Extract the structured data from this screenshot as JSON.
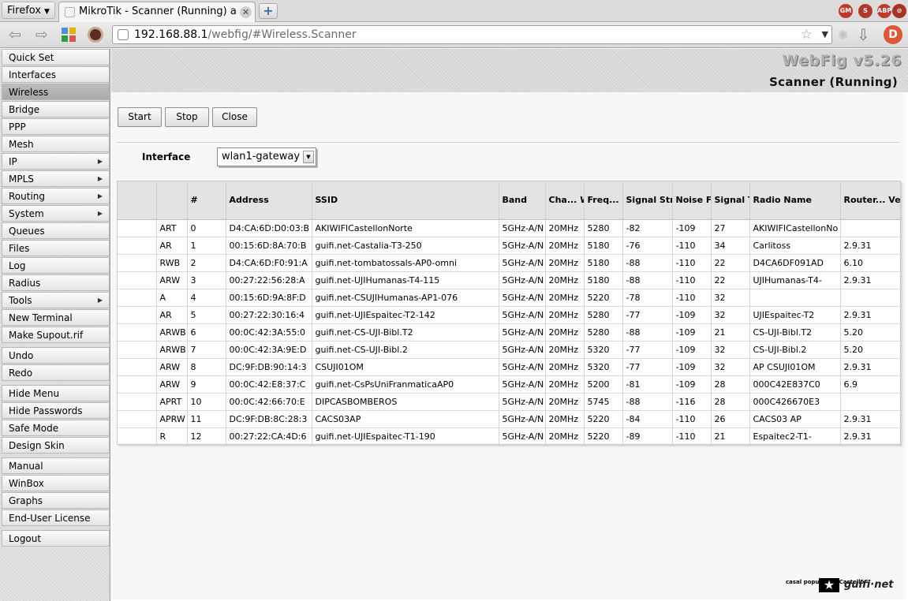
{
  "browser": {
    "menu_label": "Firefox",
    "tab_title": "MikroTik - Scanner (Running) at...",
    "url_host": "192.168.88.1",
    "url_path": "/webfig/#Wireless.Scanner",
    "addons": [
      {
        "name": "gm-icon",
        "label": "GM",
        "color": "#c0392b"
      },
      {
        "name": "noscript-icon",
        "label": "S",
        "color": "#b03a2e"
      },
      {
        "name": "abp-icon",
        "label": "ABP",
        "color": "#c0392b"
      },
      {
        "name": "blocker-icon",
        "label": "⊘",
        "color": "#a93226"
      }
    ]
  },
  "sidebar": {
    "items": [
      {
        "label": "Quick Set",
        "arrow": false,
        "active": false
      },
      {
        "label": "Interfaces",
        "arrow": false,
        "active": false
      },
      {
        "label": "Wireless",
        "arrow": false,
        "active": true
      },
      {
        "label": "Bridge",
        "arrow": false,
        "active": false
      },
      {
        "label": "PPP",
        "arrow": false,
        "active": false
      },
      {
        "label": "Mesh",
        "arrow": false,
        "active": false
      },
      {
        "label": "IP",
        "arrow": true,
        "active": false
      },
      {
        "label": "MPLS",
        "arrow": true,
        "active": false
      },
      {
        "label": "Routing",
        "arrow": true,
        "active": false
      },
      {
        "label": "System",
        "arrow": true,
        "active": false
      },
      {
        "label": "Queues",
        "arrow": false,
        "active": false
      },
      {
        "label": "Files",
        "arrow": false,
        "active": false
      },
      {
        "label": "Log",
        "arrow": false,
        "active": false
      },
      {
        "label": "Radius",
        "arrow": false,
        "active": false
      },
      {
        "label": "Tools",
        "arrow": true,
        "active": false
      },
      {
        "label": "New Terminal",
        "arrow": false,
        "active": false
      },
      {
        "label": "Make Supout.rif",
        "arrow": false,
        "active": false
      },
      {
        "label": "Undo",
        "arrow": false,
        "active": false
      },
      {
        "label": "Redo",
        "arrow": false,
        "active": false
      },
      {
        "label": "Hide Menu",
        "arrow": false,
        "active": false
      },
      {
        "label": "Hide Passwords",
        "arrow": false,
        "active": false
      },
      {
        "label": "Safe Mode",
        "arrow": false,
        "active": false
      },
      {
        "label": "Design Skin",
        "arrow": false,
        "active": false
      },
      {
        "label": "Manual",
        "arrow": false,
        "active": false
      },
      {
        "label": "WinBox",
        "arrow": false,
        "active": false
      },
      {
        "label": "Graphs",
        "arrow": false,
        "active": false
      },
      {
        "label": "End-User License",
        "arrow": false,
        "active": false
      },
      {
        "label": "Logout",
        "arrow": false,
        "active": false
      }
    ]
  },
  "header": {
    "brand": "WebFig v5.26",
    "page_title": "Scanner (Running)"
  },
  "toolbar": {
    "start_label": "Start",
    "stop_label": "Stop",
    "close_label": "Close"
  },
  "interface": {
    "label": "Interface",
    "value": "wlan1-gateway"
  },
  "table": {
    "headers": [
      "",
      "",
      "#",
      "Address",
      "SSID",
      "Band",
      "Cha... Width",
      "Freq...",
      "Signal Strength",
      "Noise Floor",
      "Signal To Noise",
      "Radio Name",
      "Router... Version"
    ],
    "rows": [
      [
        "ART",
        "0",
        "D4:CA:6D:D0:03:B",
        "AKIWIFICastellonNorte",
        "5GHz-A/N",
        "20MHz",
        "5280",
        "-82",
        "-109",
        "27",
        "AKIWIFICastellonNo",
        ""
      ],
      [
        "AR",
        "1",
        "00:15:6D:8A:70:B",
        "guifi.net-Castalia-T3-250",
        "5GHz-A/N",
        "20MHz",
        "5180",
        "-76",
        "-110",
        "34",
        "Carlitoss",
        "2.9.31"
      ],
      [
        "RWB",
        "2",
        "D4:CA:6D:F0:91:A",
        "guifi.net-tombatossals-AP0-omni",
        "5GHz-A/N",
        "20MHz",
        "5180",
        "-88",
        "-110",
        "22",
        "D4CA6DF091AD",
        "6.10"
      ],
      [
        "ARW",
        "3",
        "00:27:22:56:28:A",
        "guifi.net-UJIHumanas-T4-115",
        "5GHz-A/N",
        "20MHz",
        "5180",
        "-88",
        "-110",
        "22",
        "UJIHumanas-T4-",
        "2.9.31"
      ],
      [
        "A",
        "4",
        "00:15:6D:9A:8F:D",
        "guifi.net-CSUJIHumanas-AP1-076",
        "5GHz-A/N",
        "20MHz",
        "5220",
        "-78",
        "-110",
        "32",
        "",
        ""
      ],
      [
        "AR",
        "5",
        "00:27:22:30:16:4",
        "guifi.net-UJIEspaitec-T2-142",
        "5GHz-A/N",
        "20MHz",
        "5280",
        "-77",
        "-109",
        "32",
        "UJIEspaitec-T2",
        "2.9.31"
      ],
      [
        "ARWB",
        "6",
        "00:0C:42:3A:55:0",
        "guifi.net-CS-UJI-Bibl.T2",
        "5GHz-A/N",
        "20MHz",
        "5280",
        "-88",
        "-109",
        "21",
        "CS-UJI-Bibl.T2",
        "5.20"
      ],
      [
        "ARWB",
        "7",
        "00:0C:42:3A:9E:D",
        "guifi.net-CS-UJI-Bibl.2",
        "5GHz-A/N",
        "20MHz",
        "5320",
        "-77",
        "-109",
        "32",
        "CS-UJI-Bibl.2",
        "5.20"
      ],
      [
        "ARW",
        "8",
        "DC:9F:DB:90:14:3",
        "CSUJI01OM",
        "5GHz-A/N",
        "20MHz",
        "5320",
        "-77",
        "-109",
        "32",
        "AP CSUJI01OM",
        "2.9.31"
      ],
      [
        "ARW",
        "9",
        "00:0C:42:E8:37:C",
        "guifi.net-CsPsUniFranmaticaAP0",
        "5GHz-A/N",
        "20MHz",
        "5200",
        "-81",
        "-109",
        "28",
        "000C42E837C0",
        "6.9"
      ],
      [
        "APRT",
        "10",
        "00:0C:42:66:70:E",
        "DIPCASBOMBEROS",
        "5GHz-A/N",
        "20MHz",
        "5745",
        "-88",
        "-116",
        "28",
        "000C426670E3",
        ""
      ],
      [
        "APRW",
        "11",
        "DC:9F:DB:8C:28:3",
        "CACS03AP",
        "5GHz-A/N",
        "20MHz",
        "5220",
        "-84",
        "-110",
        "26",
        "CACS03 AP",
        "2.9.31"
      ],
      [
        "R",
        "12",
        "00:27:22:CA:4D:6",
        "guifi.net-UJIEspaitec-T1-190",
        "5GHz-A/N",
        "20MHz",
        "5220",
        "-89",
        "-110",
        "21",
        "Espaitec2-T1-",
        "2.9.31"
      ]
    ]
  },
  "footer": {
    "casal_text": "casal popular de Castelló",
    "guifi_text": "guifi·net"
  }
}
